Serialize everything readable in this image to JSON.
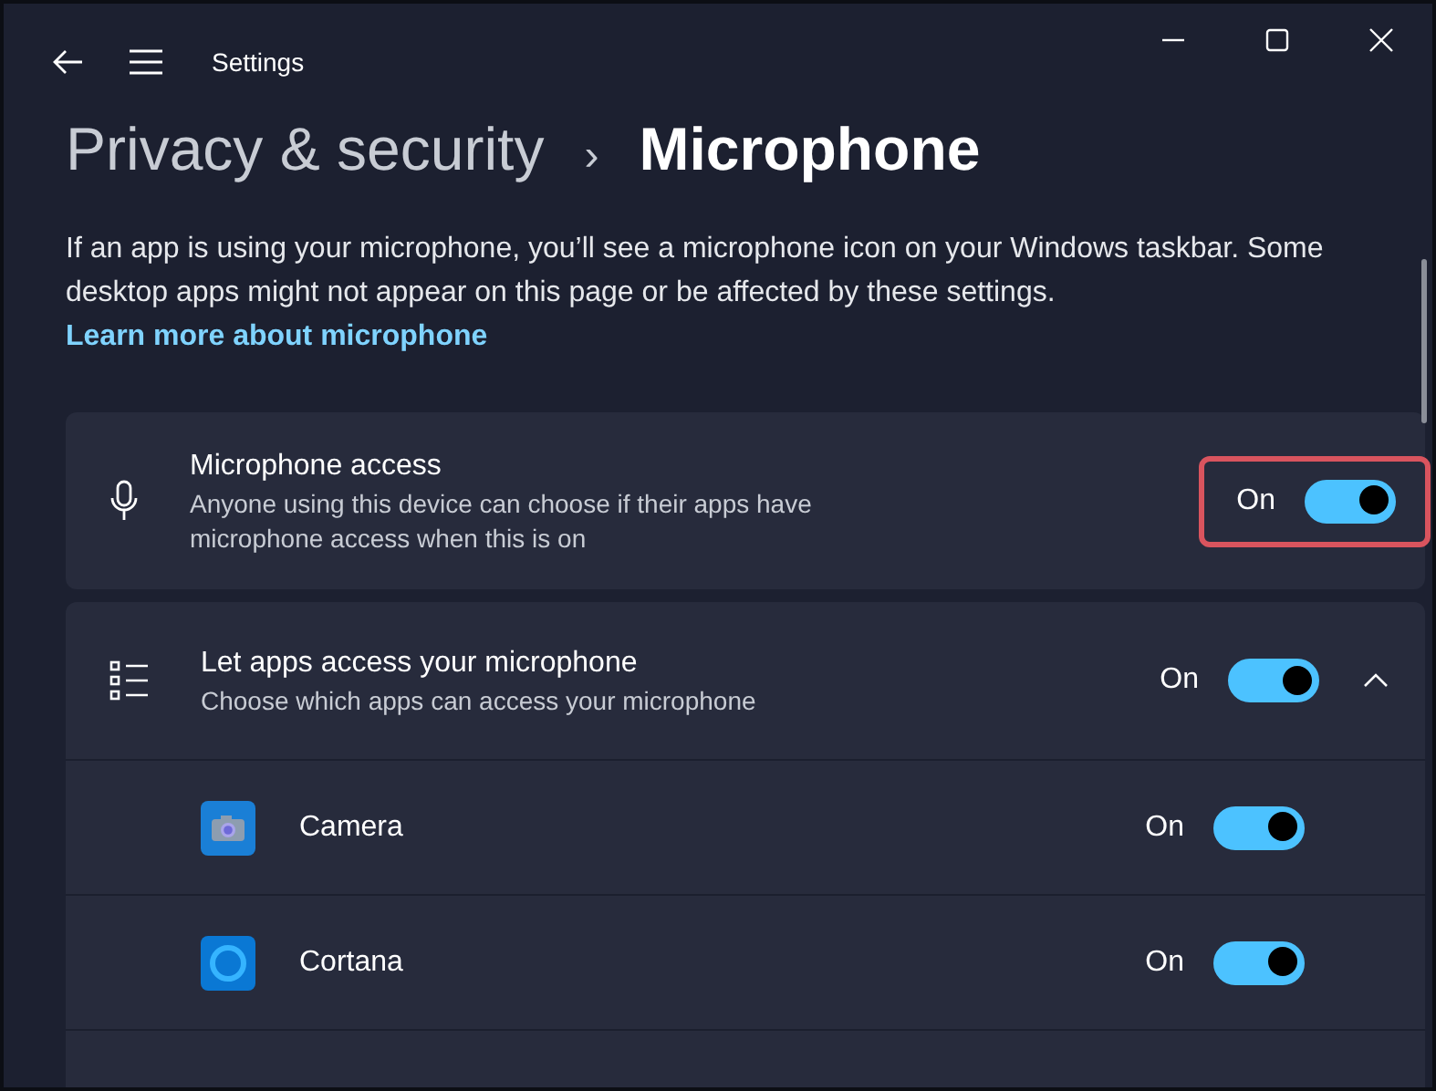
{
  "window": {
    "title": "Settings"
  },
  "breadcrumb": {
    "parent": "Privacy & security",
    "separator": "›",
    "current": "Microphone"
  },
  "description": {
    "text": "If an app is using your microphone, you’ll see a microphone icon on your Windows taskbar. Some desktop apps might not appear on this page or be affected by these settings.",
    "link": "Learn more about microphone"
  },
  "microphone_access": {
    "title": "Microphone access",
    "subtitle": "Anyone using this device can choose if their apps have microphone access when this is on",
    "state_label": "On",
    "on": true,
    "highlighted": true
  },
  "app_access": {
    "title": "Let apps access your microphone",
    "subtitle": "Choose which apps can access your microphone",
    "state_label": "On",
    "on": true,
    "expanded": true
  },
  "apps": [
    {
      "name": "Camera",
      "kind": "camera",
      "state_label": "On",
      "on": true
    },
    {
      "name": "Cortana",
      "kind": "cortana",
      "state_label": "On",
      "on": true
    }
  ]
}
